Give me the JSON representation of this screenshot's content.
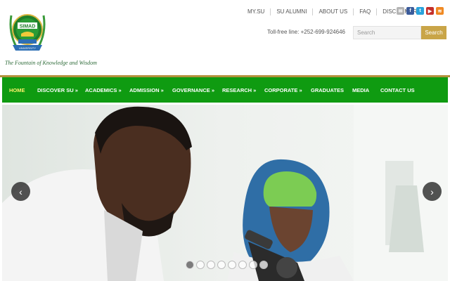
{
  "logo": {
    "text": "SIMAD",
    "ribbon": "UNIVERSITY"
  },
  "tagline": "The Fountain of Knowledge and Wisdom",
  "top_links": [
    "MY.SU",
    "SU ALUMNI",
    "ABOUT US",
    "FAQ",
    "DISCLAIMER"
  ],
  "social_icons": [
    "mail-icon",
    "facebook-icon",
    "twitter-icon",
    "youtube-icon",
    "rss-icon"
  ],
  "tollfree": "Toll-free line: +252-699-924646",
  "search": {
    "placeholder": "Search",
    "button": "Search"
  },
  "nav": [
    {
      "label": "HOME",
      "active": true
    },
    {
      "label": "DISCOVER SU »"
    },
    {
      "label": "ACADEMICS »"
    },
    {
      "label": "ADMISSION »"
    },
    {
      "label": "GOVERNANCE »"
    },
    {
      "label": "RESEARCH »"
    },
    {
      "label": "CORPORATE »"
    },
    {
      "label": "GRADUATES"
    },
    {
      "label": "MEDIA"
    },
    {
      "label": "CONTACT US"
    }
  ],
  "slider": {
    "arrow_prev": "‹",
    "arrow_next": "›",
    "dot_count": 8,
    "active_dot": 0
  },
  "colors": {
    "nav_green": "#0f9b11",
    "gold": "#b3913c",
    "search_btn": "#c9a548"
  }
}
